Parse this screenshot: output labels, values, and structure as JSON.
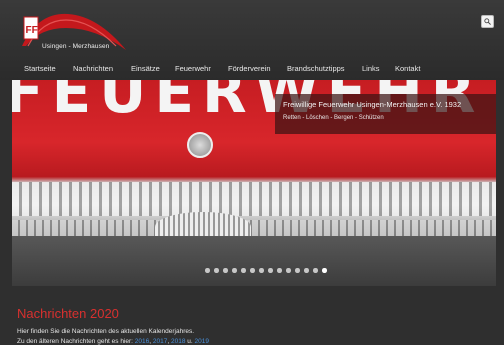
{
  "brand": {
    "logo_letters": "FF",
    "name": "Usingen - Merzhausen"
  },
  "search": {
    "icon": "search-icon"
  },
  "nav": {
    "items": [
      {
        "label": "Startseite"
      },
      {
        "label": "Nachrichten"
      },
      {
        "label": "Einsätze"
      },
      {
        "label": "Feuerwehr"
      },
      {
        "label": "Förderverein"
      },
      {
        "label": "Brandschutztipps"
      },
      {
        "label": "Links"
      },
      {
        "label": "Kontakt"
      }
    ]
  },
  "hero": {
    "word": "FEUERWEHR",
    "caption_title": "Freiwillige Feuerwehr Usingen-Merzhausen e.V. 1932",
    "caption_subtitle": "Retten - Löschen - Bergen - Schützen"
  },
  "slider": {
    "total": 14,
    "active_index": 13
  },
  "content": {
    "title": "Nachrichten 2020",
    "line1": "Hier finden Sie die Nachrichten des aktuellen Kalenderjahres.",
    "line2_prefix": "Zu den älteren Nachrichten geht es hier:",
    "archive_links": [
      "2016",
      "2017",
      "2018",
      "2019"
    ]
  },
  "colors": {
    "accent_red": "#d8302f",
    "link_blue": "#4a90d9",
    "background": "#2f2f2f"
  }
}
